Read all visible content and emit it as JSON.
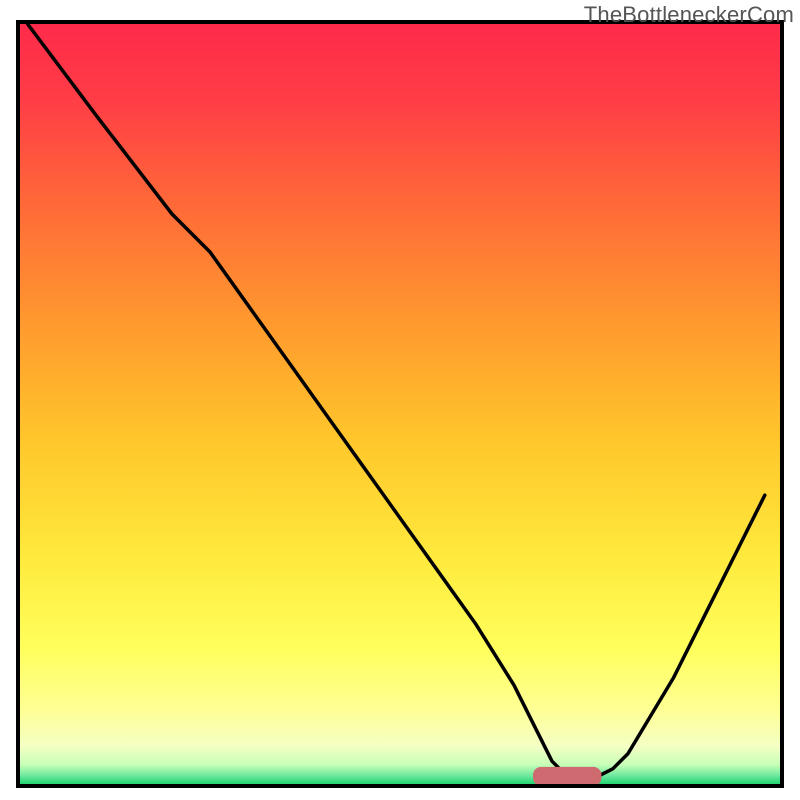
{
  "watermark": "TheBottleneckerCom",
  "chart_data": {
    "type": "line",
    "title": "",
    "xlabel": "",
    "ylabel": "",
    "xlim": [
      0,
      100
    ],
    "ylim": [
      0,
      100
    ],
    "grid": false,
    "legend": false,
    "background_gradient_colors": {
      "top": "#ff2a4a",
      "upper_mid": "#ff8a2d",
      "mid": "#ffd62b",
      "lower_mid": "#ffff5b",
      "lower": "#ffff93",
      "near_base": "#d7ffbe",
      "base": "#22d46f"
    },
    "marker": {
      "shape": "rounded-rect",
      "color": "#cf6b70",
      "x_position": 72,
      "y_position": 1,
      "width": 9,
      "height": 2.5
    },
    "series": [
      {
        "name": "curve",
        "color": "#000000",
        "x": [
          1,
          10,
          20,
          25,
          30,
          35,
          40,
          45,
          50,
          55,
          60,
          65,
          68,
          70,
          72,
          74,
          76,
          78,
          80,
          83,
          86,
          90,
          94,
          98
        ],
        "values": [
          100,
          88,
          75,
          70,
          63,
          56,
          49,
          42,
          35,
          28,
          21,
          13,
          7,
          3,
          1,
          1,
          1,
          2,
          4,
          9,
          14,
          22,
          30,
          38
        ]
      }
    ]
  }
}
